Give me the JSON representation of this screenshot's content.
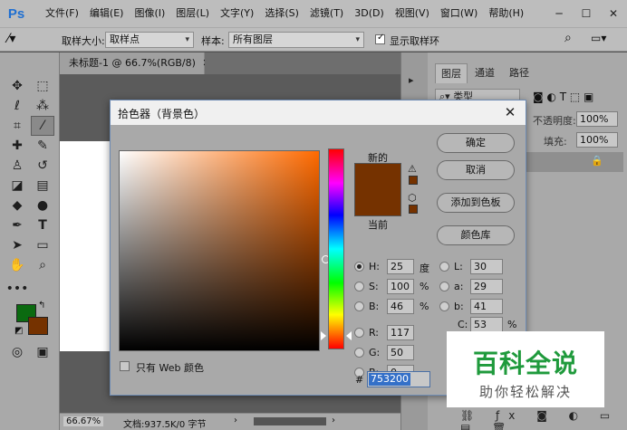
{
  "app": {
    "logo": "Ps"
  },
  "menubar": {
    "items": [
      "文件(F)",
      "编辑(E)",
      "图像(I)",
      "图层(L)",
      "文字(Y)",
      "选择(S)",
      "滤镜(T)",
      "3D(D)",
      "视图(V)",
      "窗口(W)",
      "帮助(H)"
    ]
  },
  "optionsbar": {
    "sample_size_label": "取样大小:",
    "sample_size_value": "取样点",
    "sample_label": "样本:",
    "sample_value": "所有图层",
    "show_ring_label": "显示取样环",
    "show_ring_checked": true
  },
  "document": {
    "tab_title": "未标题-1 @ 66.7%(RGB/8)",
    "zoom": "66.67%",
    "doc_info": "文档:937.5K/0 字节"
  },
  "panels": {
    "tabs": [
      "图层",
      "通道",
      "路径"
    ],
    "kind_label": "类型",
    "opacity_label": "不透明度:",
    "opacity_value": "100%",
    "fill_label": "填充:",
    "fill_value": "100%"
  },
  "toolbar": {
    "foreground_color": "#0b6a10",
    "background_color": "#753200"
  },
  "color_picker": {
    "title": "拾色器（背景色）",
    "new_label": "新的",
    "current_label": "当前",
    "new_color": "#753200",
    "current_color": "#753200",
    "buttons": {
      "ok": "确定",
      "cancel": "取消",
      "add_to_swatches": "添加到色板",
      "color_libraries": "颜色库"
    },
    "hsb": {
      "h_label": "H:",
      "h_value": "25",
      "h_unit": "度",
      "s_label": "S:",
      "s_value": "100",
      "s_unit": "%",
      "b_label": "B:",
      "b_value": "46",
      "b_unit": "%"
    },
    "rgb": {
      "r_label": "R:",
      "r_value": "117",
      "g_label": "G:",
      "g_value": "50",
      "b_label": "B:",
      "b_value": "0"
    },
    "lab": {
      "l_label": "L:",
      "l_value": "30",
      "a_label": "a:",
      "a_value": "29",
      "b_label": "b:",
      "b_value": "41"
    },
    "cmyk": {
      "c_label": "C:",
      "c_value": "53",
      "c_unit": "%"
    },
    "hex_label": "#",
    "hex_value": "753200",
    "web_only_label": "只有 Web 颜色",
    "web_only_checked": false,
    "selected_mode": "H"
  },
  "watermark": {
    "title": "百科全说",
    "subtitle": "助你轻松解决"
  }
}
